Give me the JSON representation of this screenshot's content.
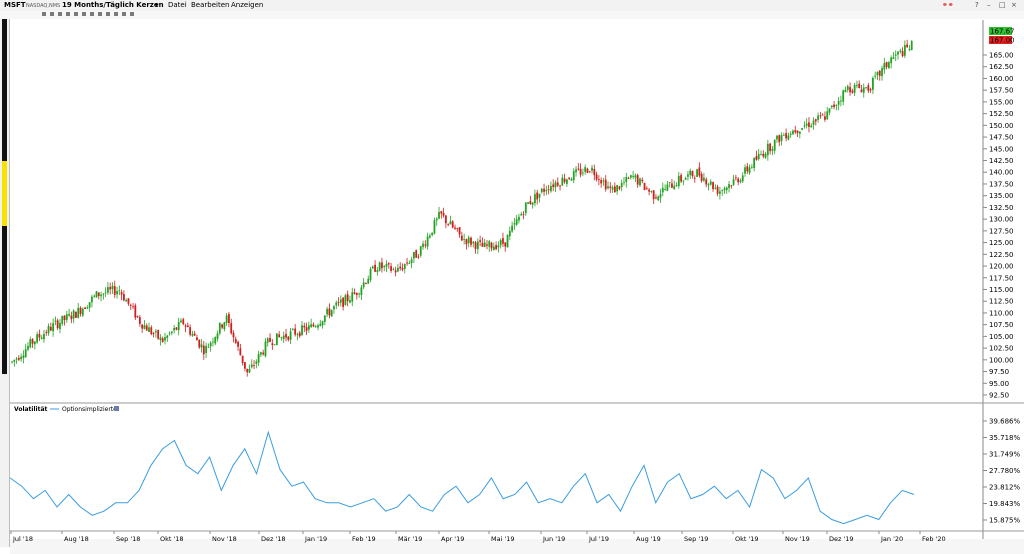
{
  "header": {
    "symbol": "MSFT",
    "exchange": "NASDAQ,NMS",
    "period": "19 Months/Täglich Kerzen",
    "menu": [
      "Datei",
      "Bearbeiten",
      "Anzeigen"
    ],
    "window_controls": [
      "?",
      "–",
      "□",
      "×"
    ]
  },
  "colors": {
    "up": "#21a321",
    "down": "#d21c1c",
    "volatility_line": "#3a9de0",
    "last_up_tag": "#2fc12f",
    "last_down_tag": "#e02020"
  },
  "price_panel": {
    "last_price_labels": [
      "167.67",
      "167.00"
    ],
    "y_ticks": [
      "165.00",
      "162.50",
      "160.00",
      "157.50",
      "155.00",
      "152.50",
      "150.00",
      "147.50",
      "145.00",
      "142.50",
      "140.00",
      "137.50",
      "135.00",
      "132.50",
      "130.00",
      "127.50",
      "125.00",
      "122.50",
      "120.00",
      "117.50",
      "115.00",
      "112.50",
      "110.00",
      "107.50",
      "105.00",
      "102.50",
      "100.00",
      "97.50",
      "95.00",
      "92.50"
    ]
  },
  "volatility_panel": {
    "title": "Volatilität",
    "legend": "Optionsimplizierte",
    "y_ticks": [
      "39.686%",
      "35.718%",
      "31.749%",
      "27.780%",
      "23.812%",
      "19.843%",
      "15.875%"
    ]
  },
  "x_axis": {
    "labels": [
      "Jul '18",
      "Aug '18",
      "Sep '18",
      "Okt '18",
      "Nov '18",
      "Dez '18",
      "Jan '19",
      "Feb '19",
      "Mär '19",
      "Apr '19",
      "Mai '19",
      "Jun '19",
      "Jul '19",
      "Aug '19",
      "Sep '19",
      "Okt '19",
      "Nov '19",
      "Dez '19",
      "Jan '20",
      "Feb '20"
    ]
  },
  "chart_data": [
    {
      "type": "candlestick",
      "title": "MSFT",
      "ylim": [
        91,
        169
      ],
      "x": [
        "Jul '18",
        "Aug '18",
        "Sep '18",
        "Okt '18",
        "Nov '18",
        "Dez '18",
        "Jan '19",
        "Feb '19",
        "Mär '19",
        "Apr '19",
        "Mai '19",
        "Jun '19",
        "Jul '19",
        "Aug '19",
        "Sep '19",
        "Okt '19",
        "Nov '19",
        "Dez '19",
        "Jan '20",
        "Feb '20"
      ],
      "anchors": [
        [
          0,
          99.5
        ],
        [
          1,
          104
        ],
        [
          2,
          107.5
        ],
        [
          3,
          110
        ],
        [
          4,
          114
        ],
        [
          5,
          115
        ],
        [
          6,
          108
        ],
        [
          7,
          104
        ],
        [
          8,
          108
        ],
        [
          9,
          102
        ],
        [
          10,
          109
        ],
        [
          11,
          97
        ],
        [
          12,
          104
        ],
        [
          13,
          105.5
        ],
        [
          14,
          107
        ],
        [
          15,
          111
        ],
        [
          16,
          114
        ],
        [
          17,
          120
        ],
        [
          18,
          119
        ],
        [
          19,
          123
        ],
        [
          20,
          131
        ],
        [
          21,
          126
        ],
        [
          22,
          124
        ],
        [
          23,
          125
        ],
        [
          24,
          133
        ],
        [
          25,
          137
        ],
        [
          26,
          139
        ],
        [
          27,
          141
        ],
        [
          28,
          136
        ],
        [
          29,
          139
        ],
        [
          30,
          135
        ],
        [
          31,
          138
        ],
        [
          32,
          140
        ],
        [
          33,
          136
        ],
        [
          34,
          139
        ],
        [
          35,
          144
        ],
        [
          36,
          148
        ],
        [
          37,
          150
        ],
        [
          38,
          152
        ],
        [
          39,
          158
        ],
        [
          40,
          158
        ],
        [
          41,
          164
        ],
        [
          42,
          167
        ]
      ],
      "anchor_x_unit": "approx half-month steps from Jul '18"
    },
    {
      "type": "line",
      "title": "Volatilität",
      "series": [
        {
          "name": "Optionsimplizierte",
          "values": [
            26,
            24,
            21,
            23,
            19,
            22,
            19,
            17,
            18,
            20,
            20,
            23,
            29,
            33,
            35,
            29,
            27,
            31,
            23,
            29,
            33,
            27,
            37,
            28,
            24,
            25,
            21,
            20,
            20,
            19,
            20,
            21,
            18,
            19,
            22,
            19,
            18,
            22,
            24,
            20,
            22,
            26,
            21,
            22,
            25,
            20,
            21,
            20,
            24,
            27,
            20,
            22,
            18,
            24,
            29,
            20,
            25,
            27,
            21,
            22,
            24,
            21,
            23,
            19,
            28,
            26,
            21,
            23,
            26,
            18,
            16,
            15,
            16,
            17,
            16,
            20,
            23,
            22
          ]
        }
      ],
      "ylim": [
        13.9,
        41.6
      ]
    }
  ]
}
